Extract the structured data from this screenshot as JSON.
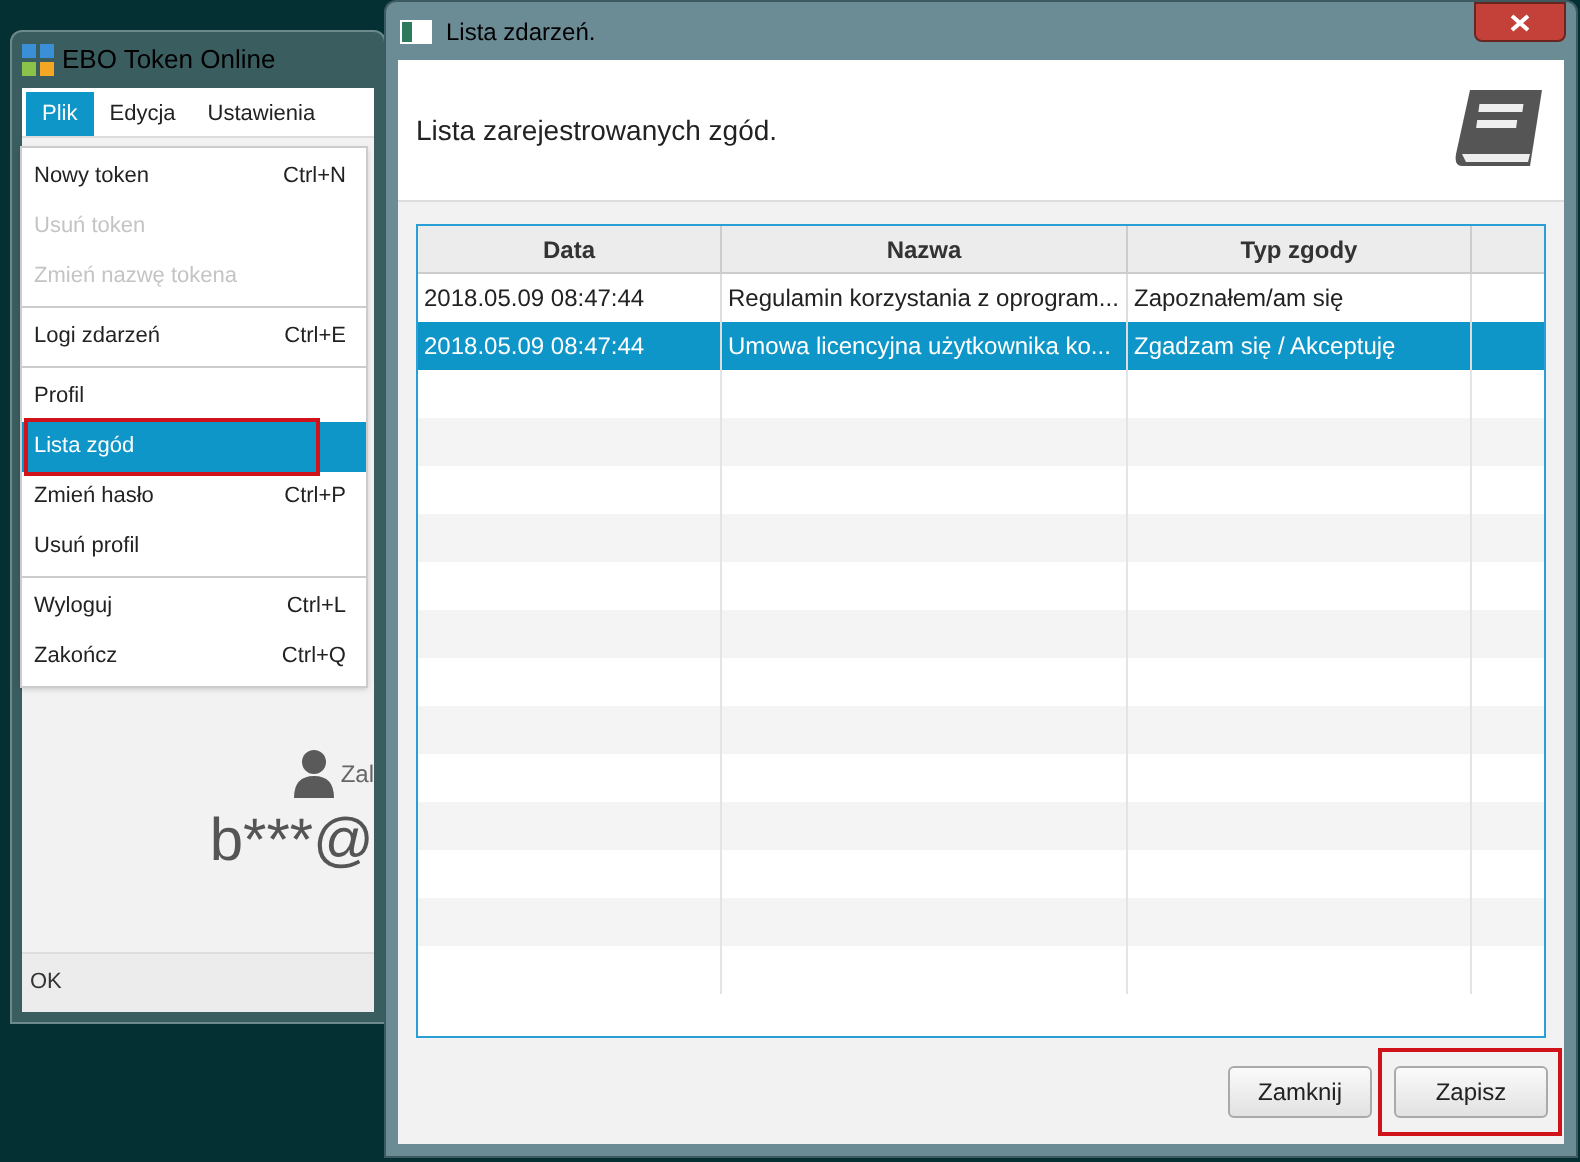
{
  "main_window": {
    "title": "EBO Token Online",
    "menu_bar": [
      {
        "label": "Plik",
        "selected": true
      },
      {
        "label": "Edycja",
        "selected": false
      },
      {
        "label": "Ustawienia",
        "selected": false
      }
    ],
    "menu": [
      {
        "kind": "item",
        "label": "Nowy token",
        "shortcut": "Ctrl+N",
        "disabled": false,
        "selected": false,
        "highlighted": false
      },
      {
        "kind": "item",
        "label": "Usuń token",
        "disabled": true,
        "selected": false,
        "highlighted": false
      },
      {
        "kind": "item",
        "label": "Zmień nazwę tokena",
        "disabled": true,
        "selected": false,
        "highlighted": false
      },
      {
        "kind": "separator"
      },
      {
        "kind": "item",
        "label": "Logi zdarzeń",
        "shortcut": "Ctrl+E",
        "disabled": false,
        "selected": false,
        "highlighted": false
      },
      {
        "kind": "separator"
      },
      {
        "kind": "item",
        "label": "Profil",
        "disabled": false,
        "selected": false,
        "highlighted": false
      },
      {
        "kind": "item",
        "label": "Lista zgód",
        "disabled": false,
        "selected": true,
        "highlighted": true
      },
      {
        "kind": "item",
        "label": "Zmień hasło",
        "shortcut": "Ctrl+P",
        "disabled": false,
        "selected": false,
        "highlighted": false
      },
      {
        "kind": "item",
        "label": "Usuń profil",
        "disabled": false,
        "selected": false,
        "highlighted": false
      },
      {
        "kind": "separator"
      },
      {
        "kind": "item",
        "label": "Wyloguj",
        "shortcut": "Ctrl+L",
        "disabled": false,
        "selected": false,
        "highlighted": false
      },
      {
        "kind": "item",
        "label": "Zakończ",
        "shortcut": "Ctrl+Q",
        "disabled": false,
        "selected": false,
        "highlighted": false
      }
    ],
    "user_label": "Zal",
    "user_email": "b***@",
    "status_bar": "OK"
  },
  "dialog": {
    "title": "Lista zdarzeń.",
    "heading": "Lista zarejestrowanych zgód.",
    "table": {
      "columns": [
        "Data",
        "Nazwa",
        "Typ zgody"
      ],
      "rows": [
        {
          "cells": [
            "2018.05.09 08:47:44",
            "Regulamin korzystania z oprogram...",
            "Zapoznałem/am się"
          ],
          "selected": false
        },
        {
          "cells": [
            "2018.05.09 08:47:44",
            "Umowa licencyjna użytkownika ko...",
            "Zgadzam się / Akceptuję"
          ],
          "selected": true
        }
      ]
    },
    "buttons": [
      {
        "label": "Zamknij",
        "highlighted": false
      },
      {
        "label": "Zapisz",
        "highlighted": true
      }
    ]
  }
}
